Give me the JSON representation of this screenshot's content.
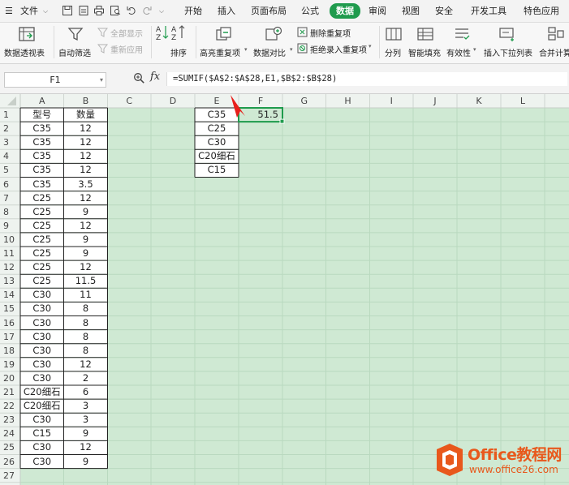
{
  "menubar": {
    "file_label": "文件",
    "tabs": [
      "开始",
      "插入",
      "页面布局",
      "公式",
      "数据",
      "审阅",
      "视图",
      "安全",
      "开发工具",
      "特色应用"
    ],
    "active_tab": "数据"
  },
  "ribbon": {
    "pivot": "数据透视表",
    "autofilter": "自动筛选",
    "show_all": "全部显示",
    "reapply": "重新应用",
    "sort": "排序",
    "highlight_dup": "高亮重复项",
    "compare": "数据对比",
    "delete_dup": "删除重复项",
    "reject_dup": "拒绝录入重复项",
    "split": "分列",
    "smart_fill": "智能填充",
    "validity": "有效性",
    "insert_dropdown": "插入下拉列表",
    "consolidate": "合并计算"
  },
  "formula_bar": {
    "name_box": "F1",
    "fx_label": "fx",
    "formula": "=SUMIF($A$2:$A$28,E1,$B$2:$B$28)"
  },
  "sheet": {
    "columns": [
      "A",
      "B",
      "C",
      "D",
      "E",
      "F",
      "G",
      "H",
      "I",
      "J",
      "K",
      "L"
    ],
    "rows": [
      "1",
      "2",
      "3",
      "4",
      "5",
      "6",
      "7",
      "8",
      "9",
      "10",
      "11",
      "12",
      "13",
      "14",
      "15",
      "16",
      "17",
      "18",
      "19",
      "20",
      "21",
      "22",
      "23",
      "24",
      "25",
      "26",
      "27"
    ],
    "colA": [
      "型号",
      "C35",
      "C35",
      "C35",
      "C35",
      "C35",
      "C25",
      "C25",
      "C25",
      "C25",
      "C25",
      "C25",
      "C25",
      "C30",
      "C30",
      "C30",
      "C30",
      "C30",
      "C30",
      "C30",
      "C20细石",
      "C20细石",
      "C30",
      "C15",
      "C30",
      "C30",
      ""
    ],
    "colB": [
      "数量",
      "12",
      "12",
      "12",
      "12",
      "3.5",
      "12",
      "9",
      "12",
      "9",
      "9",
      "12",
      "11.5",
      "11",
      "8",
      "8",
      "8",
      "8",
      "12",
      "2",
      "6",
      "3",
      "3",
      "9",
      "12",
      "9",
      ""
    ],
    "colE": [
      "C35",
      "C25",
      "C30",
      "C20细石",
      "C15"
    ],
    "F1": "51.5"
  },
  "colors": {
    "sheet_bg": "#cfe9d3",
    "gridline": "#b9d9bf",
    "accent": "#1f9b4d",
    "selection": "#1f9b4d",
    "arrow": "#e8201c",
    "watermark": "#e8581c"
  },
  "watermark": {
    "brand": "Office教程网",
    "url": "www.office26.com"
  }
}
